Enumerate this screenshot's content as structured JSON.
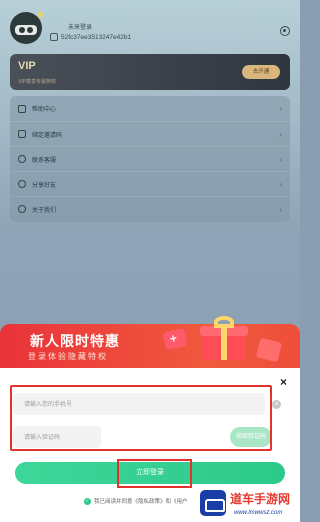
{
  "profile": {
    "username": "未来登录",
    "uid": "52fc37ee3513247e42b1"
  },
  "vip": {
    "title": "VIP",
    "subtitle": "VIP尊享专属特权",
    "button_label": "去开通"
  },
  "menu": {
    "items": [
      {
        "label": "帮助中心",
        "icon": "help-icon"
      },
      {
        "label": "绑定邀请码",
        "icon": "bookmark-icon"
      },
      {
        "label": "联系客服",
        "icon": "support-icon"
      },
      {
        "label": "分享好友",
        "icon": "share-icon"
      },
      {
        "label": "关于我们",
        "icon": "info-icon"
      }
    ],
    "arrow": "›"
  },
  "login_popup": {
    "promo_title": "新人限时特惠",
    "promo_subtitle": "登录体验隐藏特权",
    "close_glyph": "×",
    "phone_placeholder": "请输入您的手机号",
    "code_placeholder": "请输入验证码",
    "code_button_label": "获取验证码",
    "clear_glyph": "×",
    "login_button_label": "立即登录",
    "agreement_text": "我已阅读并同意《隐私政策》和《用户",
    "accent_color": "#2cc98a",
    "highlight_color": "#e1322c"
  },
  "watermark": {
    "title": "道车手游网",
    "url": "www.lmwwsz.com"
  }
}
